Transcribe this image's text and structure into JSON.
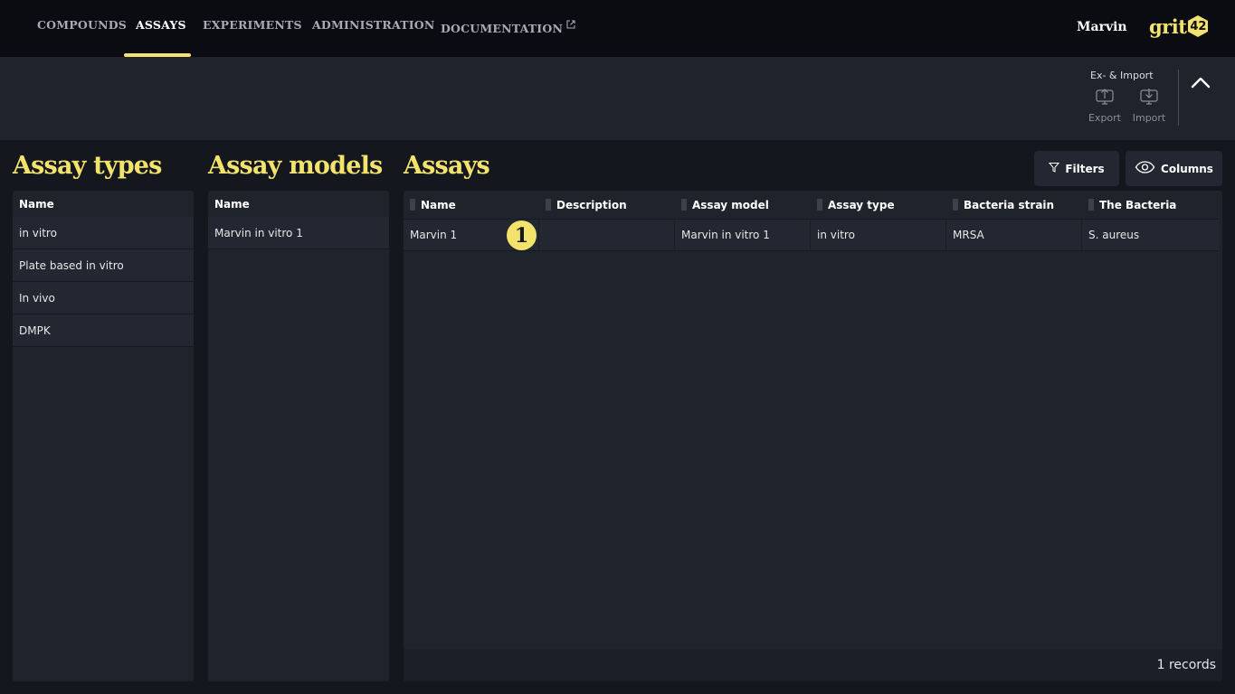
{
  "nav": {
    "items": [
      {
        "label": "COMPOUNDS",
        "active": false
      },
      {
        "label": "ASSAYS",
        "active": true
      },
      {
        "label": "EXPERIMENTS",
        "active": false
      },
      {
        "label": "ADMINISTRATION",
        "active": false
      },
      {
        "label": "DOCUMENTATION",
        "active": false,
        "icon": "external-link-icon"
      }
    ],
    "user": "Marvin",
    "logo_text": "grit",
    "logo_number": "42"
  },
  "toolbar": {
    "group_title": "Ex- & Import",
    "export_label": "Export",
    "import_label": "Import",
    "collapse_icon": "chevron-up-icon"
  },
  "assay_types": {
    "title": "Assay types",
    "column": "Name",
    "rows": [
      "in vitro",
      "Plate based in vitro",
      "In vivo",
      "DMPK"
    ]
  },
  "assay_models": {
    "title": "Assay models",
    "column": "Name",
    "rows": [
      "Marvin in vitro 1"
    ]
  },
  "assays": {
    "title": "Assays",
    "filters_label": "Filters",
    "columns_label": "Columns",
    "columns": [
      "Name",
      "Description",
      "Assay model",
      "Assay type",
      "Bacteria strain",
      "The Bacteria"
    ],
    "rows": [
      [
        "Marvin 1",
        "",
        "Marvin in vitro 1",
        "in vitro",
        "MRSA",
        "S. aureus"
      ]
    ],
    "records_text": "1 records",
    "callout_number": "1"
  },
  "colors": {
    "accent": "#f3e26c",
    "nav_bg": "#0b0c11",
    "panel_bg": "#1f232c",
    "page_bg": "#14171e"
  }
}
